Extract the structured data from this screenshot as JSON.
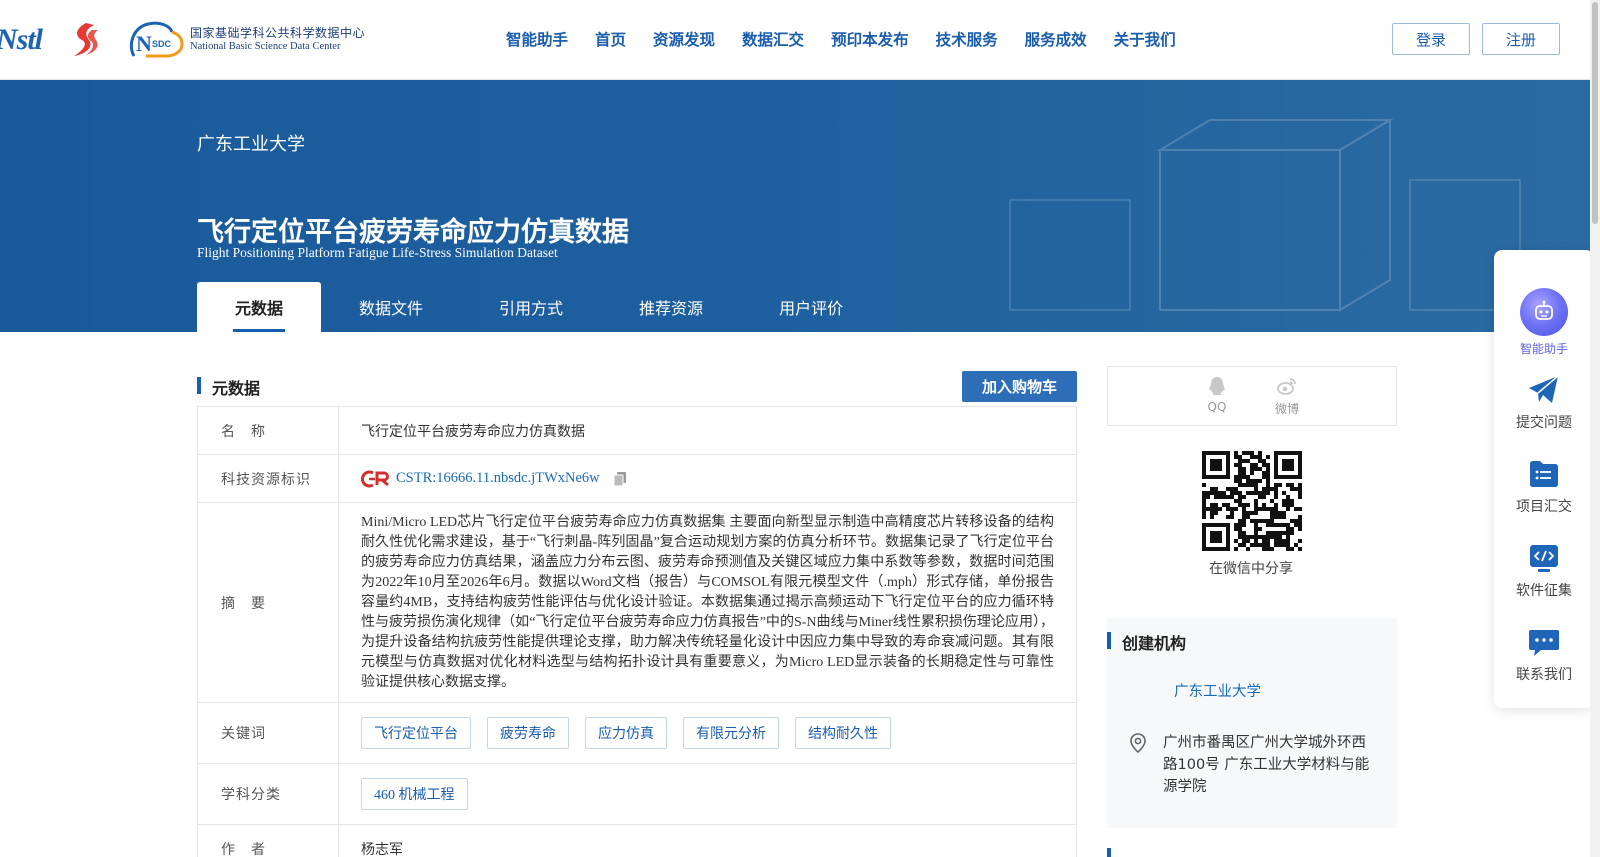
{
  "header": {
    "logo_nstl": "Nstl",
    "logo_nsdc_cn": "国家基础学科公共科学数据中心",
    "logo_nsdc_en": "National Basic Science Data Center",
    "nav": [
      "智能助手",
      "首页",
      "资源发现",
      "数据汇交",
      "预印本发布",
      "技术服务",
      "服务成效",
      "关于我们"
    ],
    "login": "登录",
    "register": "注册"
  },
  "banner": {
    "institution": "广东工业大学",
    "title": "飞行定位平台疲劳寿命应力仿真数据",
    "title_en": "Flight Positioning Platform Fatigue Life-Stress Simulation Dataset",
    "tabs": [
      "元数据",
      "数据文件",
      "引用方式",
      "推荐资源",
      "用户评价"
    ],
    "active_tab": "元数据"
  },
  "metadata": {
    "section_title": "元数据",
    "cart_button": "加入购物车",
    "rows": {
      "name_label": "名　称",
      "name_value": "飞行定位平台疲劳寿命应力仿真数据",
      "id_label": "科技资源标识",
      "id_value": "CSTR:16666.11.nbsdc.jTWxNe6w",
      "abstract_label": "摘　要",
      "abstract_value": "Mini/Micro LED芯片飞行定位平台疲劳寿命应力仿真数据集 主要面向新型显示制造中高精度芯片转移设备的结构耐久性优化需求建设，基于“飞行刺晶-阵列固晶”复合运动规划方案的仿真分析环节。数据集记录了飞行定位平台的疲劳寿命应力仿真结果，涵盖应力分布云图、疲劳寿命预测值及关键区域应力集中系数等参数，数据时间范围为2022年10月至2026年6月。数据以Word文档（报告）与COMSOL有限元模型文件（.mph）形式存储，单份报告容量约4MB，支持结构疲劳性能评估与优化设计验证。本数据集通过揭示高频运动下飞行定位平台的应力循环特性与疲劳损伤演化规律（如“飞行定位平台疲劳寿命应力仿真报告”中的S-N曲线与Miner线性累积损伤理论应用），为提升设备结构抗疲劳性能提供理论支撑，助力解决传统轻量化设计中因应力集中导致的寿命衰减问题。其有限元模型与仿真数据对优化材料选型与结构拓扑设计具有重要意义，为Micro LED显示装备的长期稳定性与可靠性验证提供核心数据支撑。",
      "keywords_label": "关键词",
      "keywords": [
        "飞行定位平台",
        "疲劳寿命",
        "应力仿真",
        "有限元分析",
        "结构耐久性"
      ],
      "subject_label": "学科分类",
      "subject_value": "460 机械工程",
      "author_label": "作　者",
      "author_value": "杨志军"
    }
  },
  "share": {
    "qq": "QQ",
    "weibo": "微博",
    "wechat_label": "在微信中分享"
  },
  "org": {
    "title": "创建机构",
    "name": "广东工业大学",
    "address": "广州市番禺区广州大学城外环西路100号 广东工业大学材料与能源学院"
  },
  "side_panel": {
    "ai": "智能助手",
    "submit": "提交问题",
    "project": "项目汇交",
    "software": "软件征集",
    "contact": "联系我们"
  },
  "colors": {
    "brand": "#1a5dad",
    "banner": "#1d5f9f",
    "link": "#1a6bb8"
  }
}
